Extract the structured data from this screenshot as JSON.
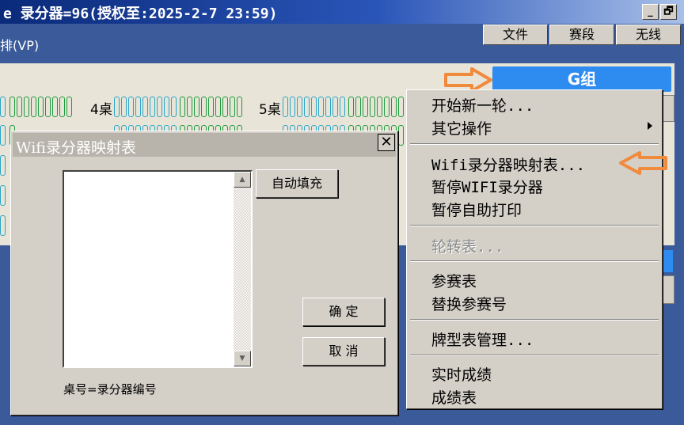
{
  "window": {
    "title": "e 录分器=96(授权至:2025-2-7 23:59)",
    "minimize_glyph": "_",
    "restore_glyph": "🗗"
  },
  "menubar": [
    {
      "label": "文件"
    },
    {
      "label": "赛段"
    },
    {
      "label": "无线"
    }
  ],
  "subtitle": "排(VP)",
  "group": {
    "label": "G组"
  },
  "tables": {
    "t4": "4桌",
    "t5": "5桌"
  },
  "dialog": {
    "title": "Wifi录分器映射表",
    "close_glyph": "✕",
    "autofill_label": "自动填充",
    "ok_label": "确 定",
    "cancel_label": "取 消",
    "hint": "桌号=录分器编号",
    "list_items": []
  },
  "context_menu": {
    "new_round": "开始新一轮...",
    "other_ops": "其它操作",
    "wifi_map": "Wifi录分器映射表...",
    "pause_wifi": "暂停WIFI录分器",
    "pause_print": "暂停自助打印",
    "rotation": "轮转表...",
    "entries": "参赛表",
    "replace_no": "替换参赛号",
    "deck_mgmt": "牌型表管理...",
    "live_score": "实时成绩",
    "score_table": "成绩表"
  },
  "colors": {
    "accent": "#2e8bf0",
    "annotation_arrow": "#f08a3c"
  },
  "icons": {
    "arrow_group": "right-arrow-annotation",
    "arrow_menu": "left-arrow-annotation"
  }
}
